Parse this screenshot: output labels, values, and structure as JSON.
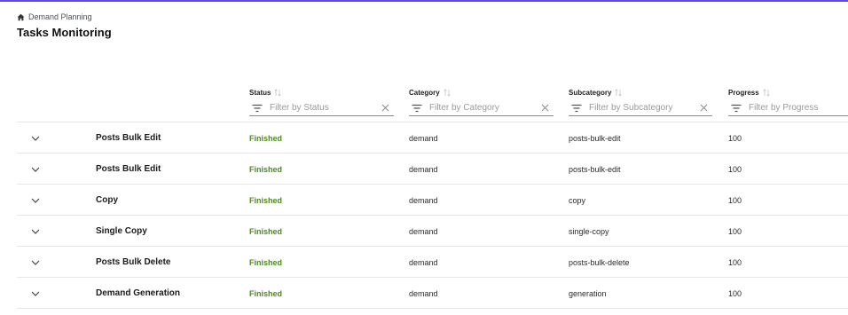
{
  "breadcrumb": {
    "label": "Demand Planning"
  },
  "page": {
    "title": "Tasks Monitoring"
  },
  "columns": {
    "status": {
      "label": "Status",
      "placeholder": "Filter by Status"
    },
    "category": {
      "label": "Category",
      "placeholder": "Filter by Category"
    },
    "subcategory": {
      "label": "Subcategory",
      "placeholder": "Filter by Subcategory"
    },
    "progress": {
      "label": "Progress",
      "placeholder": "Filter by Progress"
    }
  },
  "rows": [
    {
      "name": "Posts Bulk Edit",
      "status": "Finished",
      "category": "demand",
      "subcategory": "posts-bulk-edit",
      "progress": "100"
    },
    {
      "name": "Posts Bulk Edit",
      "status": "Finished",
      "category": "demand",
      "subcategory": "posts-bulk-edit",
      "progress": "100"
    },
    {
      "name": "Copy",
      "status": "Finished",
      "category": "demand",
      "subcategory": "copy",
      "progress": "100"
    },
    {
      "name": "Single Copy",
      "status": "Finished",
      "category": "demand",
      "subcategory": "single-copy",
      "progress": "100"
    },
    {
      "name": "Posts Bulk Delete",
      "status": "Finished",
      "category": "demand",
      "subcategory": "posts-bulk-delete",
      "progress": "100"
    },
    {
      "name": "Demand Generation",
      "status": "Finished",
      "category": "demand",
      "subcategory": "generation",
      "progress": "100"
    }
  ],
  "colors": {
    "accent": "#5b4be8",
    "status_finished": "#4b8a1e"
  },
  "icons": {
    "breadcrumb": "home-icon",
    "sort": "sort-icon",
    "filter": "filter-icon",
    "clear": "close-icon",
    "expand": "chevron-down-icon"
  }
}
